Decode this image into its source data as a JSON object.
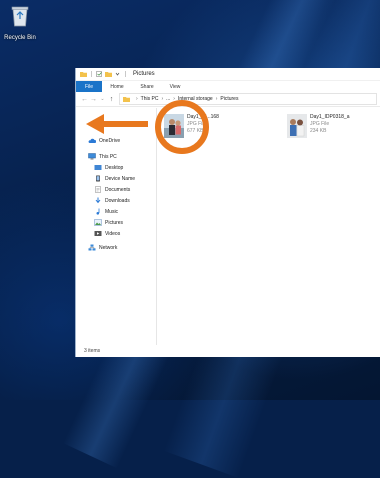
{
  "desktop": {
    "recycle_bin_label": "Recycle Bin"
  },
  "window": {
    "title": "Pictures",
    "ribbon_tabs": [
      "File",
      "Home",
      "Share",
      "View"
    ],
    "breadcrumb": [
      "This PC",
      "...",
      "Internal storage",
      "Pictures"
    ],
    "nav_pane": {
      "onedrive": "OneDrive",
      "this_pc": "This PC",
      "desktop": "Desktop",
      "device_name": "Device Name",
      "documents": "Documents",
      "downloads": "Downloads",
      "music": "Music",
      "pictures": "Pictures",
      "videos": "Videos",
      "network": "Network"
    },
    "files": [
      {
        "name": "Day1_IC...168",
        "type": "JPG File",
        "size": "677 KB"
      },
      {
        "name": "Day1_IDP0318_a",
        "type": "JPG File",
        "size": "234 KB"
      }
    ],
    "status": "3 items"
  },
  "annotation": {
    "color": "#e8781e"
  }
}
